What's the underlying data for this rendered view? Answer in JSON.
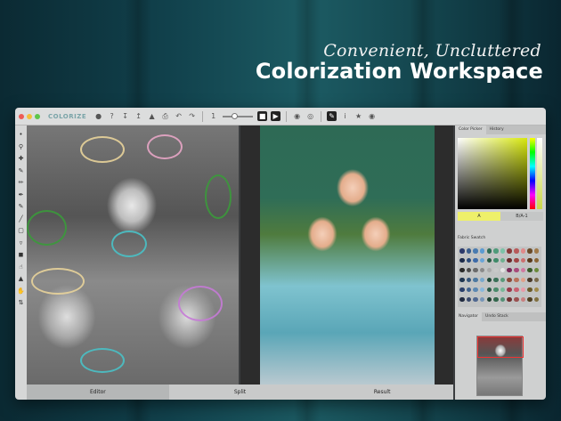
{
  "headline": {
    "script": "Convenient, Uncluttered",
    "main": "Colorization Workspace"
  },
  "app": {
    "brand": "COLORIZE"
  },
  "toolbar": {
    "zoom_value": "1"
  },
  "panels": {
    "color_picker_tab": "Color Picker",
    "history_tab": "History",
    "swatch_a": "A",
    "swatch_b": "B/A-1",
    "palette_label": "Fabric Swatch",
    "navigator_tab": "Navigator",
    "undo_stack_tab": "Undo Stack"
  },
  "statusbar": {
    "editor": "Editor",
    "split": "Split",
    "result": "Result"
  },
  "colors": {
    "accent": "#7aa4a8",
    "window_bg": "#3b3d3f",
    "panel_bg": "#cfd0d0"
  },
  "palette_colors": [
    "#2b3a6b",
    "#3a5d8c",
    "#4a7bb0",
    "#5b9bd2",
    "#2f6d57",
    "#4f9b7a",
    "#7cc3a8",
    "#8a3a3a",
    "#b85a5a",
    "#e08a8a",
    "#6b4c2a",
    "#a07a4a",
    "#1c2b4a",
    "#2a4a7a",
    "#3d6aa8",
    "#6aa5d8",
    "#2a5a45",
    "#3f8a68",
    "#6fb090",
    "#6a2a2a",
    "#a04444",
    "#cc7070",
    "#5a3a1c",
    "#8a6434",
    "#2a2a2a",
    "#4a4a4a",
    "#6a6a6a",
    "#8a8a8a",
    "#aaaaaa",
    "#c8c8c8",
    "#e4e4e4",
    "#7a2a5a",
    "#a84a7a",
    "#d07aa0",
    "#3a5a2a",
    "#6a8a3a",
    "#1f3550",
    "#35557a",
    "#4d78a0",
    "#78a8cc",
    "#234a3a",
    "#3a7058",
    "#5a9a7a",
    "#8c4a3a",
    "#b8705a",
    "#e0a08a",
    "#4a3a2a",
    "#7a6a4a",
    "#2a3f6a",
    "#40628e",
    "#5c88b2",
    "#88b8dc",
    "#2c5a48",
    "#4a8a6a",
    "#78b898",
    "#9a3a4a",
    "#c86070",
    "#e89aa8",
    "#6a5a2a",
    "#a08a4a",
    "#202a40",
    "#38486a",
    "#506890",
    "#7896b8",
    "#1f3f30",
    "#33664c",
    "#559077",
    "#703030",
    "#9a5050",
    "#c88080",
    "#504020",
    "#807040"
  ]
}
